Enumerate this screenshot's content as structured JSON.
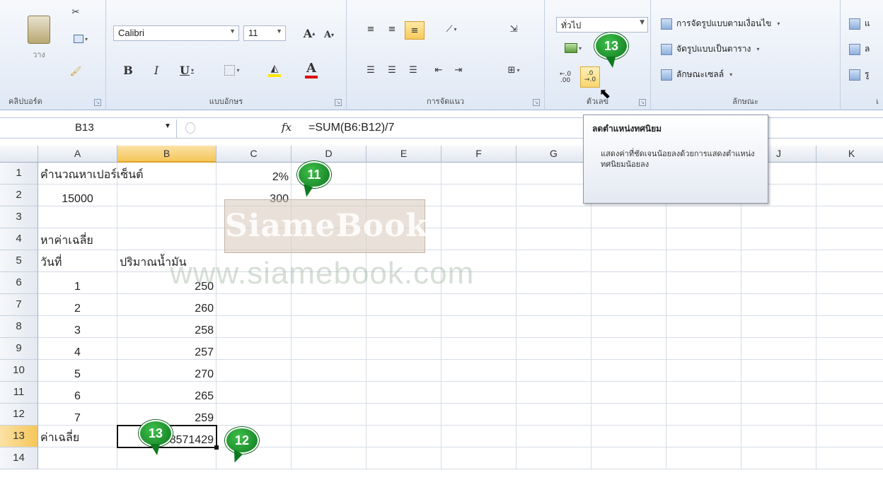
{
  "ribbon": {
    "clipboard": {
      "paste_label": "วาง",
      "group_label": "คลิปบอร์ด"
    },
    "font": {
      "name": "Calibri",
      "size": "11",
      "group_label": "แบบอักษร",
      "bold": "B",
      "italic": "I",
      "underline": "U",
      "grow": "A",
      "shrink": "A",
      "color_a": "A"
    },
    "alignment": {
      "group_label": "การจัดแนว"
    },
    "number": {
      "format": "ทั่วไป",
      "group_label": "ตัวเลข",
      "inc_decimal": ".00",
      "dec_decimal": ".0"
    },
    "styles": {
      "group_label": "ลักษณะ",
      "conditional": "การจัดรูปแบบตามเงื่อนไข",
      "as_table": "จัดรูปแบบเป็นตาราง",
      "cell_styles": "ลักษณะเซลล์"
    },
    "cells": {
      "ins": "แ",
      "del": "ล",
      "fmt": "รู",
      "group_label": "เ"
    }
  },
  "formula_bar": {
    "name_box": "B13",
    "fx": "fx",
    "formula": "=SUM(B6:B12)/7"
  },
  "tooltip": {
    "title": "ลดตำแหน่งทศนิยม",
    "body": "แสดงค่าที่ชัดเจนน้อยลงด้วยการแสดงตำแหน่งทศนิยมน้อยลง"
  },
  "columns": [
    "A",
    "B",
    "C",
    "D",
    "E",
    "F",
    "G",
    "H",
    "I",
    "J",
    "K"
  ],
  "rows": [
    "1",
    "2",
    "3",
    "4",
    "5",
    "6",
    "7",
    "8",
    "9",
    "10",
    "11",
    "12",
    "13",
    "14"
  ],
  "cells": {
    "A1": "คำนวณหาเปอร์เซ็นต์",
    "C1": "2%",
    "A2": "15000",
    "C2": "300",
    "A4": "หาค่าเฉลี่ย",
    "A5": "วันที่",
    "B5": "ปริมาณน้ำมัน",
    "A6": "1",
    "B6": "250",
    "A7": "2",
    "B7": "260",
    "A8": "3",
    "B8": "258",
    "A9": "4",
    "B9": "257",
    "A10": "5",
    "B10": "270",
    "A11": "6",
    "B11": "265",
    "A12": "7",
    "B12": "259",
    "A13": "ค่าเฉลี่ย",
    "B13": "259.8571429"
  },
  "watermark": {
    "logo": "SiameBook",
    "url": "www.siamebook.com"
  },
  "badges": {
    "b11": "11",
    "b12": "12",
    "b13_ribbon": "13",
    "b13_cell": "13"
  },
  "colors": {
    "badge_green": "#1a9a2c",
    "selection": "#f5c659"
  }
}
